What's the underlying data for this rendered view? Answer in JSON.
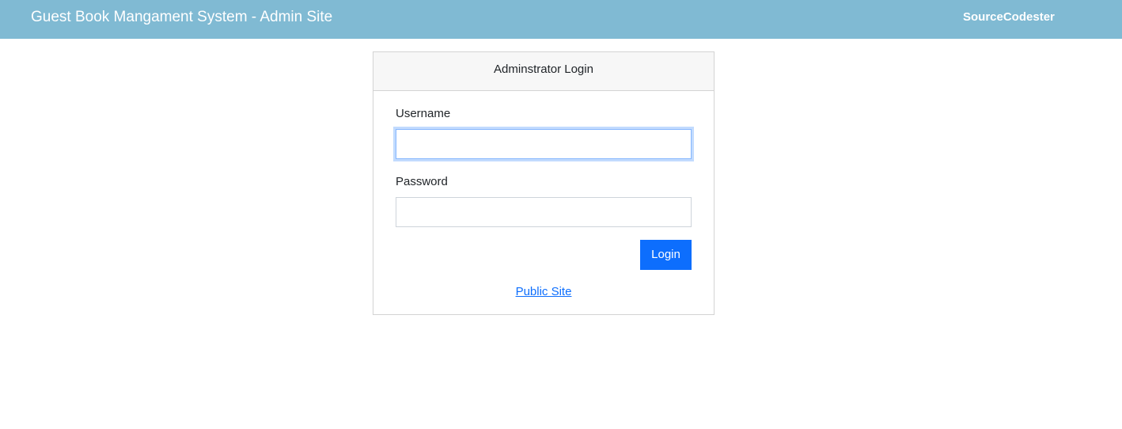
{
  "navbar": {
    "brand": "Guest Book Mangament System - Admin Site",
    "right_text": "SourceCodester",
    "bg_color": "#80bad3"
  },
  "login_card": {
    "header": "Adminstrator Login",
    "username_label": "Username",
    "username_value": "",
    "password_label": "Password",
    "password_value": "",
    "login_button": "Login",
    "public_site_link": "Public Site"
  },
  "colors": {
    "primary": "#0d6efd",
    "focus_border": "#86b7fe"
  }
}
